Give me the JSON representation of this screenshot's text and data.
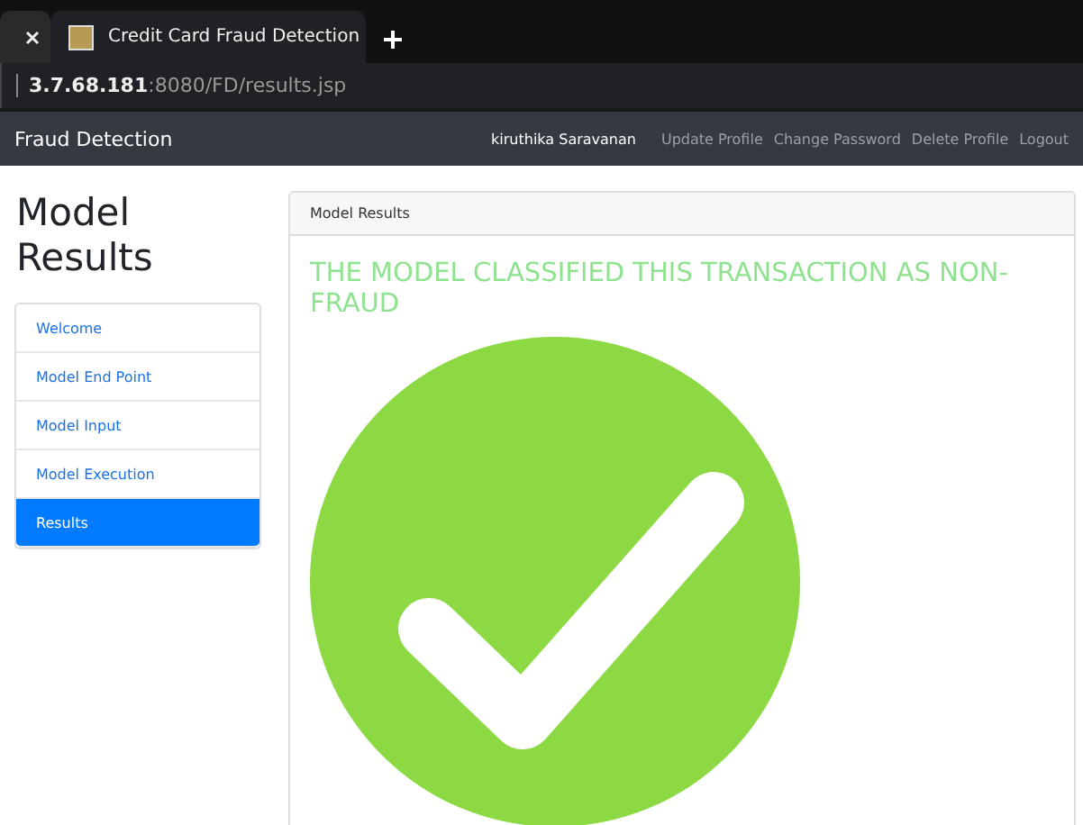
{
  "browser": {
    "tabs": [
      {
        "selected": false
      },
      {
        "title": "Credit Card Fraud Detection",
        "selected": true
      }
    ],
    "address": {
      "host": "3.7.68.181",
      "rest": ":8080/FD/results.jsp"
    }
  },
  "navbar": {
    "brand": "Fraud Detection",
    "user": "kiruthika Saravanan",
    "links": [
      "Update Profile",
      "Change Password",
      "Delete Profile",
      "Logout"
    ]
  },
  "page_title": "Model Results",
  "sidebar": {
    "items": [
      {
        "label": "Welcome",
        "selected": false
      },
      {
        "label": "Model End Point",
        "selected": false
      },
      {
        "label": "Model Input",
        "selected": false
      },
      {
        "label": "Model Execution",
        "selected": false
      },
      {
        "label": "Results",
        "selected": true
      }
    ]
  },
  "card": {
    "header": "Model Results",
    "message": "THE MODEL CLASSIFIED THIS TRANSACTION AS NON-FRAUD",
    "result": {
      "kind": "success"
    }
  }
}
